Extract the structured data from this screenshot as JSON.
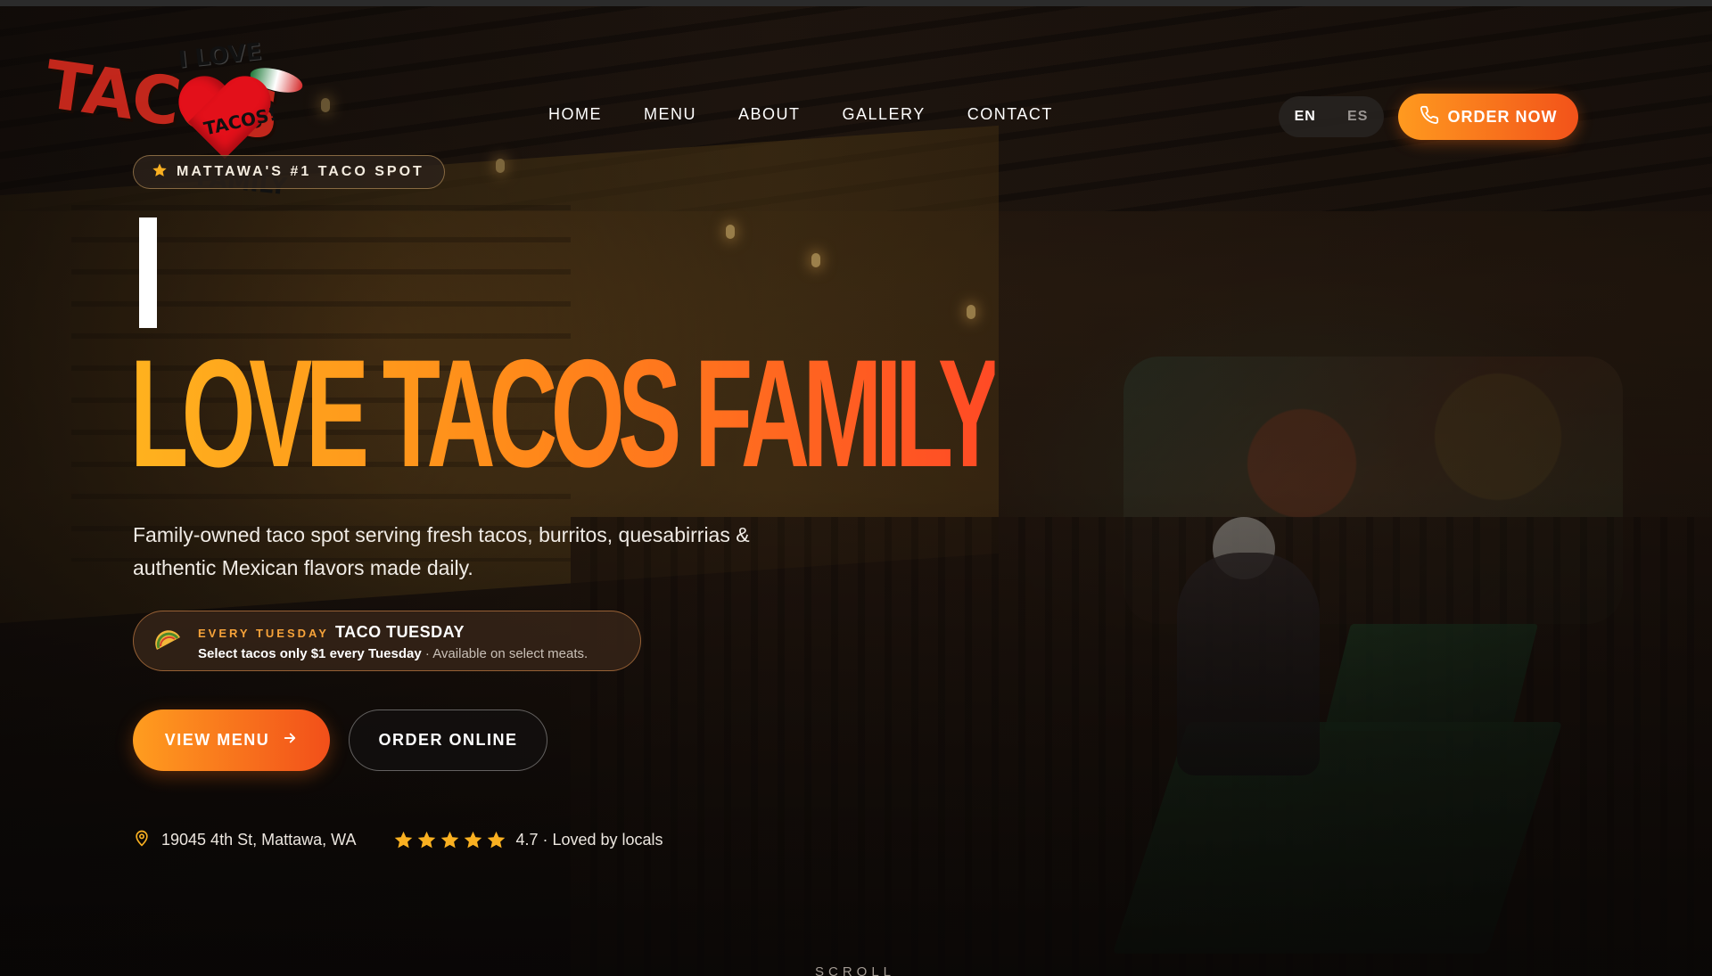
{
  "logo": {
    "big_text": "TACOS",
    "tagline_top": "I LOVE",
    "heart_text": "TACOS!",
    "tagline_bottom": "FAMILY"
  },
  "nav": {
    "items": [
      {
        "label": "HOME"
      },
      {
        "label": "MENU"
      },
      {
        "label": "ABOUT"
      },
      {
        "label": "GALLERY"
      },
      {
        "label": "CONTACT"
      }
    ]
  },
  "language": {
    "options": [
      "EN",
      "ES"
    ],
    "selected": "EN"
  },
  "header": {
    "order_now_label": "ORDER NOW",
    "phone_icon": "phone-icon"
  },
  "hero": {
    "badge": "MATTAWA'S #1 TACO SPOT",
    "badge_icon": "star-icon",
    "title": "LOVE TACOS FAMILY",
    "description": "Family-owned taco spot serving fresh tacos, burritos, quesabirrias & authentic Mexican flavors made daily."
  },
  "promo": {
    "icon": "taco-icon",
    "kicker": "EVERY TUESDAY",
    "heading": "TACO TUESDAY",
    "offer": "Select tacos only $1 every Tuesday",
    "separator": " · ",
    "note": "Available on select meats."
  },
  "buttons": {
    "view_menu": "VIEW MENU",
    "order_online": "ORDER ONLINE"
  },
  "info": {
    "address": "19045 4th St, Mattawa, WA",
    "rating_value": 4.7,
    "rating_stars": 5,
    "rating_text": "4.7 · Loved by locals"
  },
  "scroll_label": "SCROLL",
  "colors": {
    "accent_start": "#ff9d1f",
    "accent_end": "#f24f1a",
    "star": "#f9b021",
    "kicker": "#f7a33a"
  }
}
